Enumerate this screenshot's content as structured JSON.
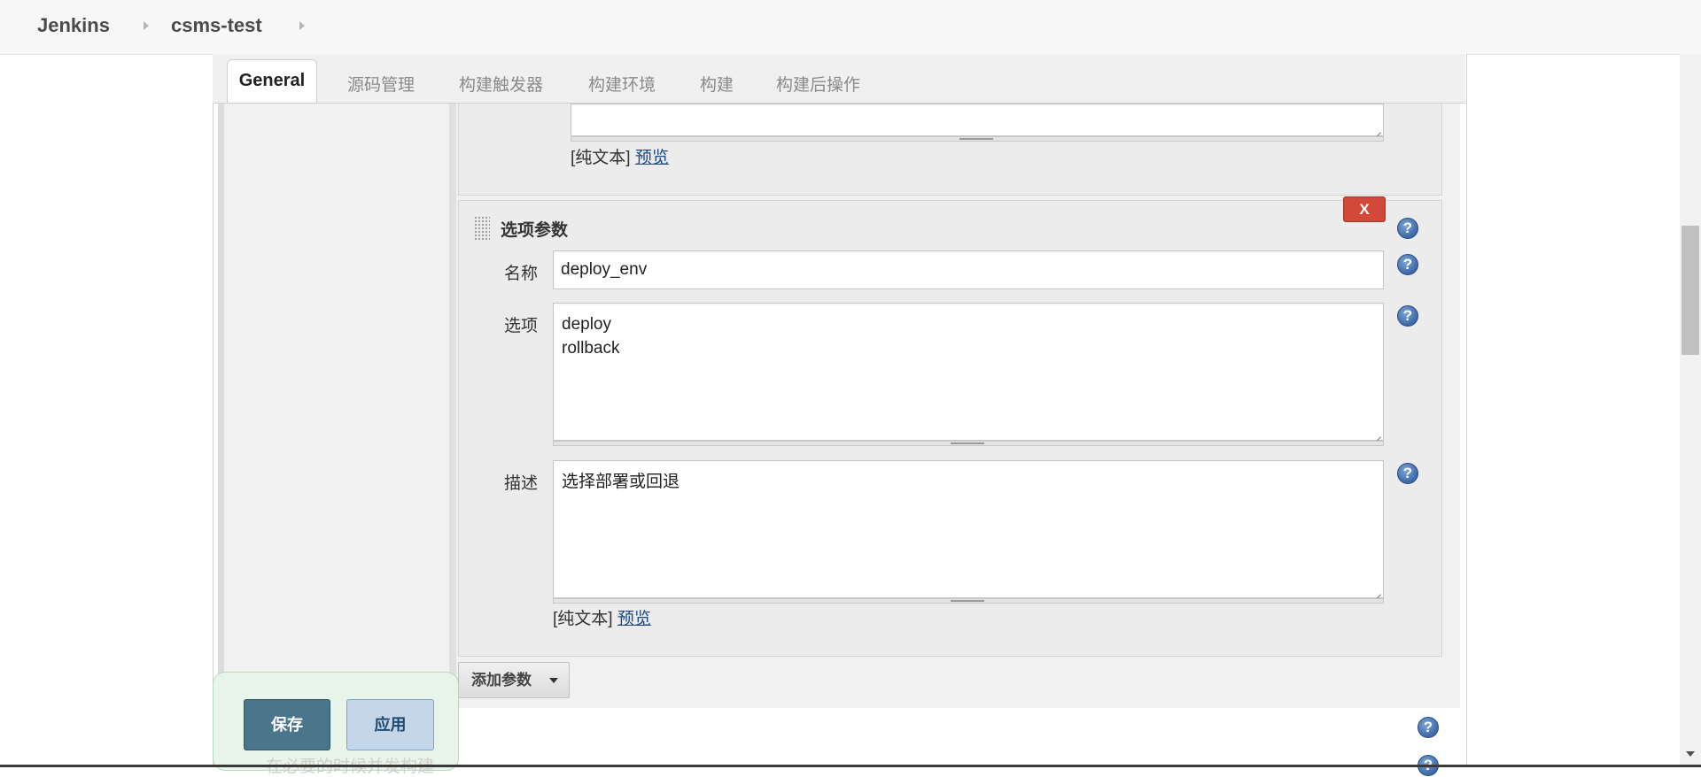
{
  "breadcrumb": {
    "home": "Jenkins",
    "project": "csms-test"
  },
  "tabs": [
    {
      "label": "General"
    },
    {
      "label": "源码管理"
    },
    {
      "label": "构建触发器"
    },
    {
      "label": "构建环境"
    },
    {
      "label": "构建"
    },
    {
      "label": "构建后操作"
    }
  ],
  "prev_param": {
    "format_label": "[纯文本]",
    "preview_link": "预览"
  },
  "choice_param": {
    "title": "选项参数",
    "delete_label": "X",
    "name_label": "名称",
    "name_value": "deploy_env",
    "choices_label": "选项",
    "choices_value": "deploy\nrollback",
    "description_label": "描述",
    "description_value": "选择部署或回退",
    "format_label": "[纯文本]",
    "preview_link": "预览"
  },
  "add_param_label": "添加参数",
  "help_glyph": "?",
  "save_bar": {
    "save": "保存",
    "apply": "应用",
    "ghost_text": "在必要的时候并发构建"
  }
}
